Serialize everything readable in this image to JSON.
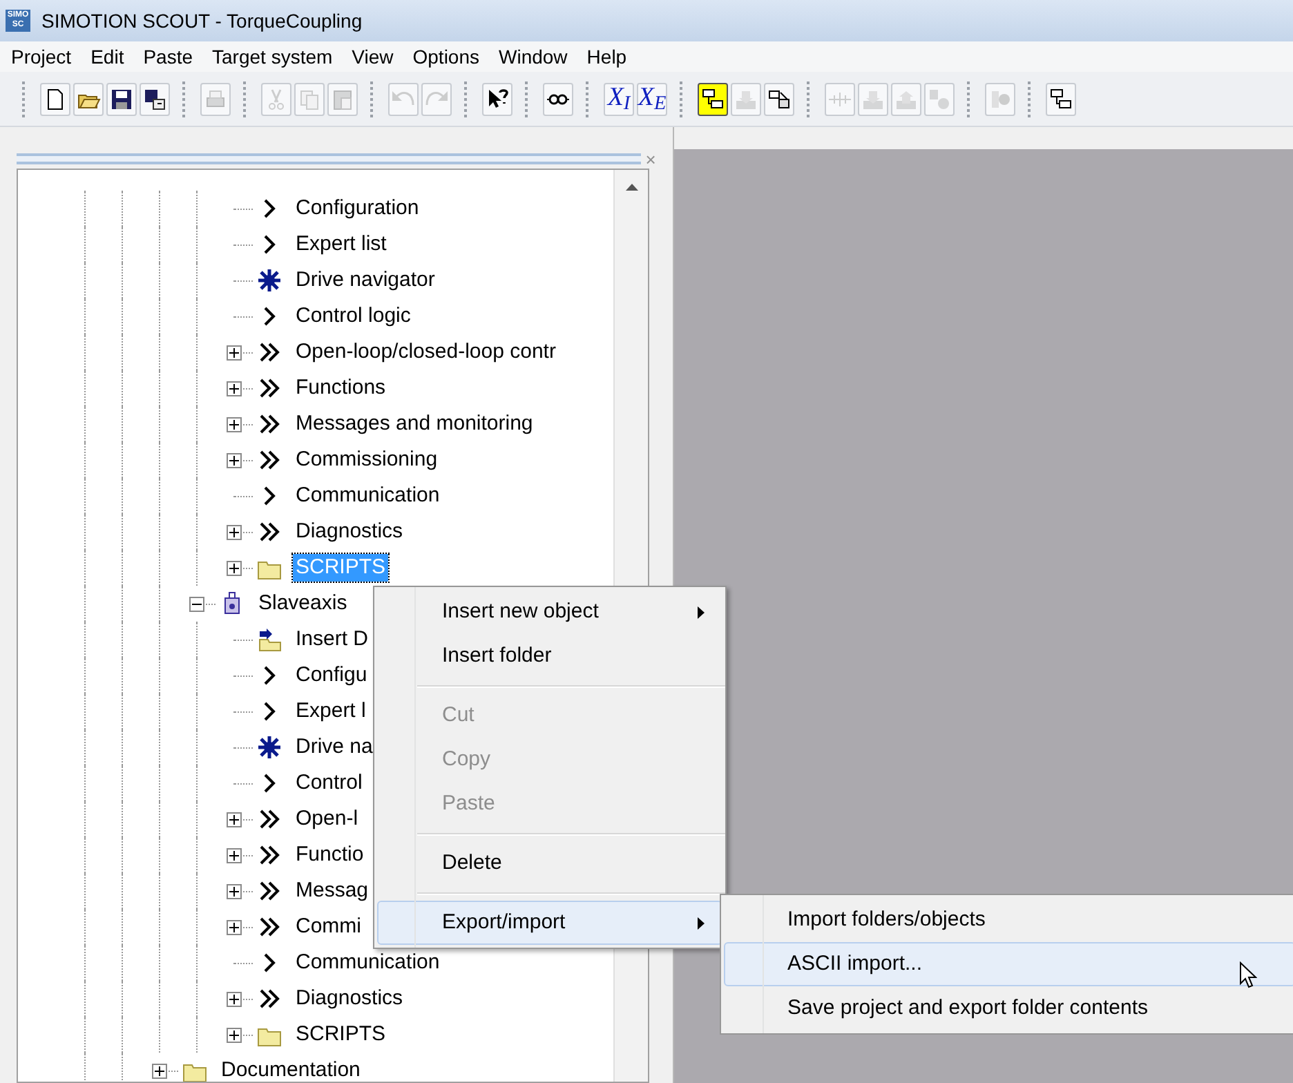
{
  "window": {
    "title": "SIMOTION SCOUT - TorqueCoupling",
    "logo": [
      "SIMO",
      "SC"
    ]
  },
  "menu_bar": [
    "Project",
    "Edit",
    "Paste",
    "Target system",
    "View",
    "Options",
    "Window",
    "Help"
  ],
  "toolbar": [
    [
      {
        "kind": "new",
        "disabled": false
      },
      {
        "kind": "open",
        "disabled": false
      },
      {
        "kind": "save",
        "disabled": false
      },
      {
        "kind": "download",
        "disabled": false
      }
    ],
    [
      {
        "kind": "print",
        "disabled": true
      }
    ],
    [
      {
        "kind": "cut",
        "disabled": true
      },
      {
        "kind": "copy",
        "disabled": true
      },
      {
        "kind": "paste",
        "disabled": true
      }
    ],
    [
      {
        "kind": "undo",
        "disabled": true
      },
      {
        "kind": "redo",
        "disabled": true
      }
    ],
    [
      {
        "kind": "help",
        "disabled": false
      }
    ],
    [
      {
        "kind": "connect",
        "disabled": false
      }
    ],
    [
      {
        "kind": "symbol",
        "text": "X$_{I}$",
        "disabled": false
      },
      {
        "kind": "symbol",
        "text": "X$_{E}$",
        "disabled": false
      }
    ],
    [
      {
        "kind": "network",
        "disabled": false,
        "pressed": true
      },
      {
        "kind": "load",
        "disabled": true
      },
      {
        "kind": "stack",
        "disabled": false
      }
    ],
    [
      {
        "kind": "split",
        "disabled": true
      },
      {
        "kind": "load",
        "disabled": true
      },
      {
        "kind": "upload",
        "disabled": true
      },
      {
        "kind": "compare",
        "disabled": true
      }
    ],
    [
      {
        "kind": "record",
        "disabled": true
      }
    ],
    [
      {
        "kind": "network",
        "disabled": false
      }
    ]
  ],
  "pane": {
    "close": "×"
  },
  "tree": [
    {
      "children": [
        {
          "children": [
            {
              "children": [
                {
                  "children": [
                    {
                      "label": "Configuration",
                      "kind": "single",
                      "selected": false
                    },
                    {
                      "label": "Expert list",
                      "kind": "single",
                      "selected": false
                    },
                    {
                      "label": "Drive navigator",
                      "kind": "navigator",
                      "selected": false
                    },
                    {
                      "label": "Control logic",
                      "kind": "single",
                      "selected": false
                    },
                    {
                      "label": "Open-loop/closed-loop contr",
                      "kind": "double",
                      "expanded": false,
                      "selected": false
                    },
                    {
                      "label": "Functions",
                      "kind": "double",
                      "expanded": false,
                      "selected": false
                    },
                    {
                      "label": "Messages and monitoring",
                      "kind": "double",
                      "expanded": false,
                      "selected": false
                    },
                    {
                      "label": "Commissioning",
                      "kind": "double",
                      "expanded": false,
                      "selected": false
                    },
                    {
                      "label": "Communication",
                      "kind": "single",
                      "selected": false
                    },
                    {
                      "label": "Diagnostics",
                      "kind": "double",
                      "expanded": false,
                      "selected": false
                    },
                    {
                      "label": "SCRIPTS",
                      "kind": "folder",
                      "expanded": false,
                      "selected": true
                    }
                  ]
                },
                {
                  "label": "Slaveaxis",
                  "kind": "axis",
                  "expanded": true,
                  "selected": false,
                  "children": [
                    {
                      "label": "Insert D",
                      "kind": "insert",
                      "selected": false
                    },
                    {
                      "label": "Configu",
                      "kind": "single",
                      "selected": false
                    },
                    {
                      "label": "Expert l",
                      "kind": "single",
                      "selected": false
                    },
                    {
                      "label": "Drive na",
                      "kind": "navigator",
                      "selected": false
                    },
                    {
                      "label": "Control",
                      "kind": "single",
                      "selected": false
                    },
                    {
                      "label": "Open-l",
                      "kind": "double",
                      "expanded": false,
                      "selected": false
                    },
                    {
                      "label": "Functio",
                      "kind": "double",
                      "expanded": false,
                      "selected": false
                    },
                    {
                      "label": "Messag",
                      "kind": "double",
                      "expanded": false,
                      "selected": false
                    },
                    {
                      "label": "Commi",
                      "kind": "double",
                      "expanded": false,
                      "selected": false
                    },
                    {
                      "label": "Communication",
                      "kind": "single",
                      "selected": false
                    },
                    {
                      "label": "Diagnostics",
                      "kind": "double",
                      "expanded": false,
                      "selected": false
                    },
                    {
                      "label": "SCRIPTS",
                      "kind": "folder",
                      "expanded": false,
                      "selected": false
                    }
                  ]
                }
              ]
            },
            {
              "label": "Documentation",
              "kind": "folder",
              "expanded": false,
              "selected": false
            }
          ]
        }
      ]
    }
  ],
  "context_menu": [
    {
      "kind": "item",
      "label": "Insert new object",
      "submenu": true,
      "disabled": false,
      "selected": false
    },
    {
      "kind": "item",
      "label": "Insert folder",
      "submenu": false,
      "disabled": false,
      "selected": false
    },
    {
      "kind": "separator"
    },
    {
      "kind": "item",
      "label": "Cut",
      "submenu": false,
      "disabled": true,
      "selected": false
    },
    {
      "kind": "item",
      "label": "Copy",
      "submenu": false,
      "disabled": true,
      "selected": false
    },
    {
      "kind": "item",
      "label": "Paste",
      "submenu": false,
      "disabled": true,
      "selected": false
    },
    {
      "kind": "separator"
    },
    {
      "kind": "item",
      "label": "Delete",
      "submenu": false,
      "disabled": false,
      "selected": false
    },
    {
      "kind": "separator"
    },
    {
      "kind": "item",
      "label": "Export/import",
      "submenu": true,
      "disabled": false,
      "selected": true
    }
  ],
  "submenu": [
    {
      "label": "Import folders/objects",
      "selected": false
    },
    {
      "label": "ASCII import...",
      "selected": true
    },
    {
      "label": "Save project and export folder contents",
      "selected": false
    }
  ]
}
